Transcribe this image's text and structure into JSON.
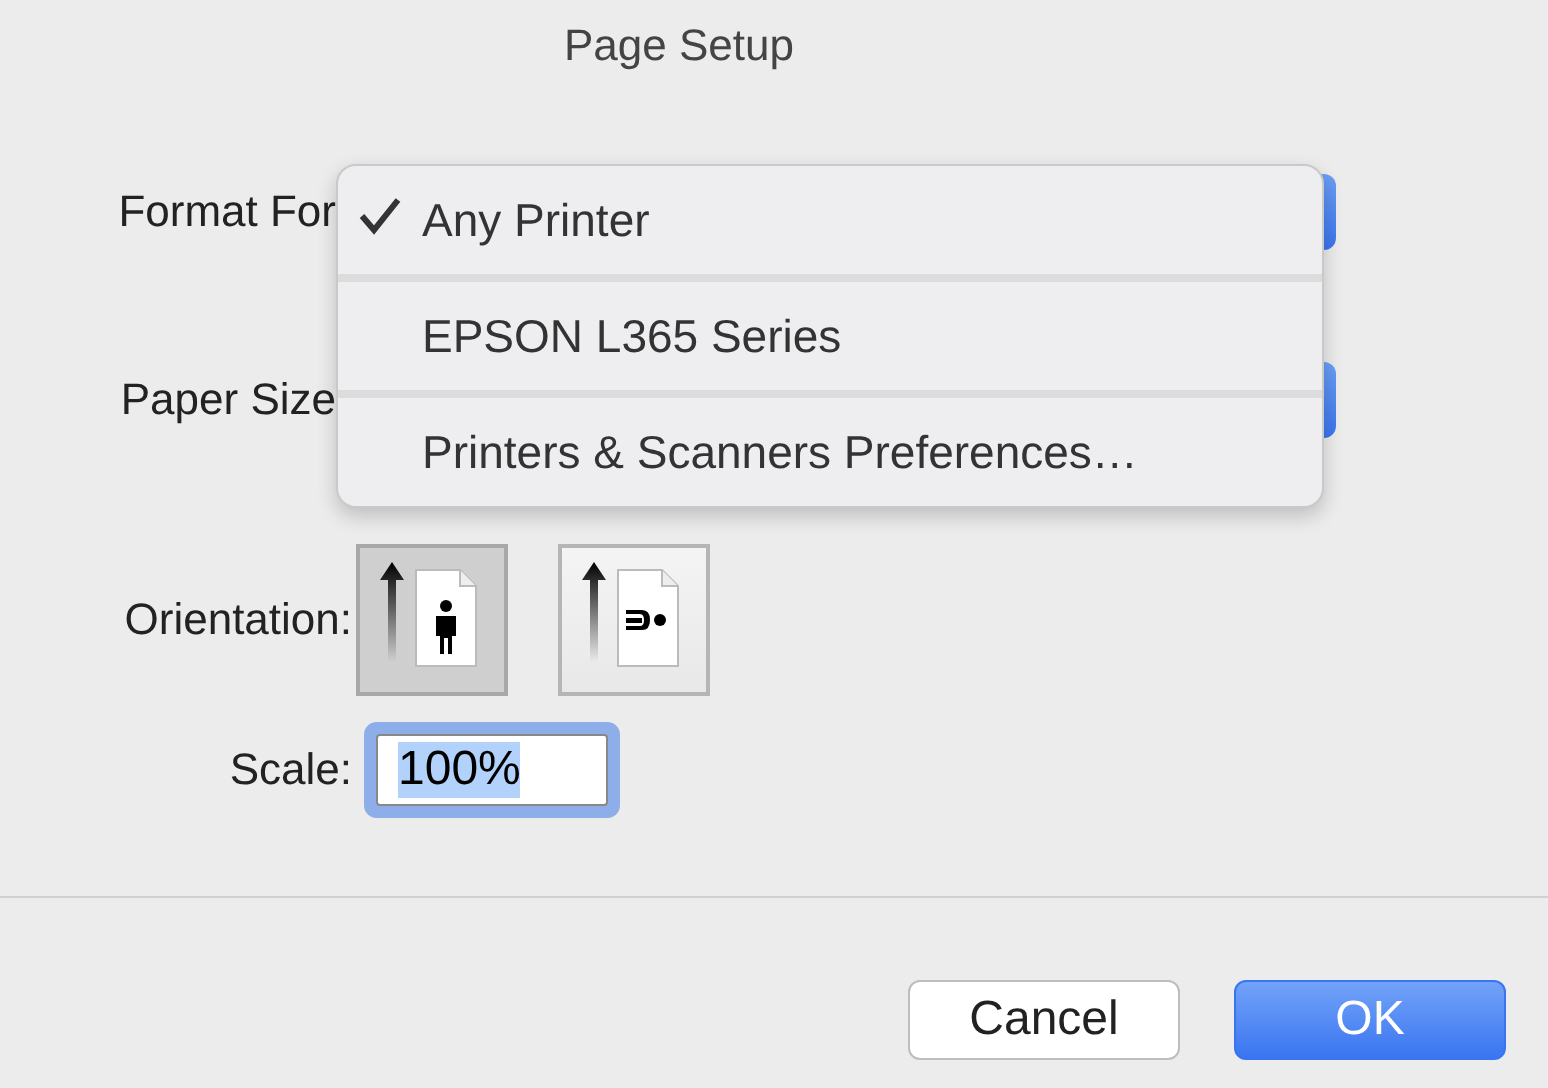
{
  "window": {
    "title": "Page Setup"
  },
  "format_for": {
    "label": "Format For"
  },
  "paper_size": {
    "label": "Paper Size"
  },
  "menu": {
    "items": [
      {
        "label": "Any Printer",
        "selected": true
      },
      {
        "label": "EPSON L365 Series",
        "selected": false
      },
      {
        "label": "Printers & Scanners Preferences…",
        "selected": false
      }
    ]
  },
  "orientation": {
    "label": "Orientation:",
    "options": [
      {
        "kind": "portrait",
        "selected": true
      },
      {
        "kind": "landscape",
        "selected": false
      }
    ]
  },
  "scale": {
    "label": "Scale:",
    "value": "100%"
  },
  "buttons": [
    {
      "label": "Cancel",
      "default": false
    },
    {
      "label": "OK",
      "default": true
    }
  ]
}
